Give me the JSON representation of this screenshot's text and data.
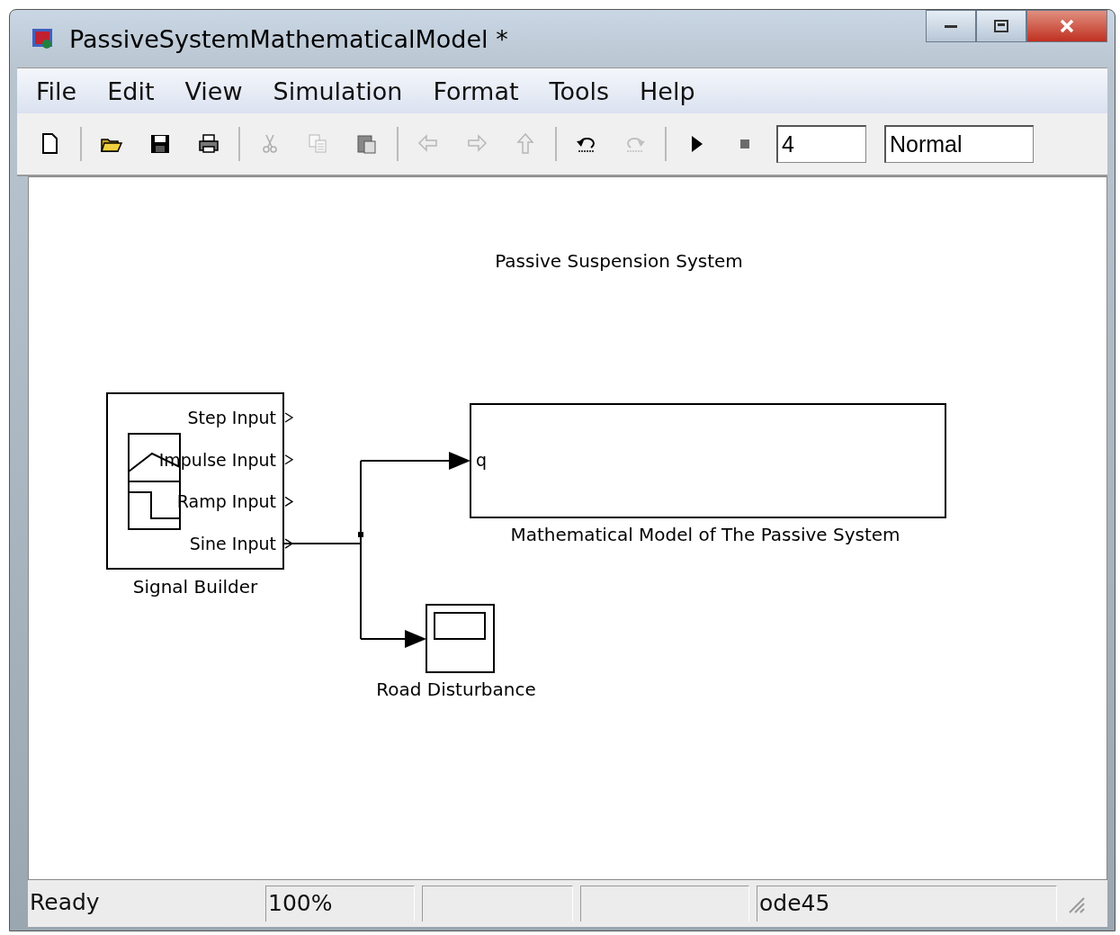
{
  "window": {
    "title": "PassiveSystemMathematicalModel *"
  },
  "menu": [
    "File",
    "Edit",
    "View",
    "Simulation",
    "Format",
    "Tools",
    "Help"
  ],
  "toolbar": {
    "buttons": [
      {
        "kind": "new",
        "disabled": false
      },
      {
        "kind": "open",
        "disabled": false
      },
      {
        "kind": "save",
        "disabled": false
      },
      {
        "kind": "print",
        "disabled": false
      },
      {
        "kind": "cut",
        "disabled": true
      },
      {
        "kind": "copy",
        "disabled": true
      },
      {
        "kind": "paste",
        "disabled": false
      },
      {
        "kind": "back",
        "disabled": true
      },
      {
        "kind": "forward",
        "disabled": true
      },
      {
        "kind": "up",
        "disabled": true
      },
      {
        "kind": "undo",
        "disabled": false
      },
      {
        "kind": "redo",
        "disabled": true
      },
      {
        "kind": "start",
        "disabled": false
      },
      {
        "kind": "stop",
        "disabled": true
      }
    ],
    "stop_time": "4",
    "mode": "Normal"
  },
  "diagram": {
    "annotation": "Passive Suspension System",
    "blocks": [
      {
        "kind": "signal_builder",
        "label": "Signal Builder",
        "outputs": [
          "Step Input",
          "Impulse Input",
          "Ramp Input",
          "Sine Input"
        ]
      },
      {
        "kind": "subsystem",
        "label": "Mathematical Model of The Passive System",
        "inputs": [
          "q"
        ]
      },
      {
        "kind": "scope",
        "label": "Road Disturbance"
      }
    ]
  },
  "status_bar": {
    "message": "Ready",
    "zoom": "100%",
    "solver": "ode45"
  }
}
